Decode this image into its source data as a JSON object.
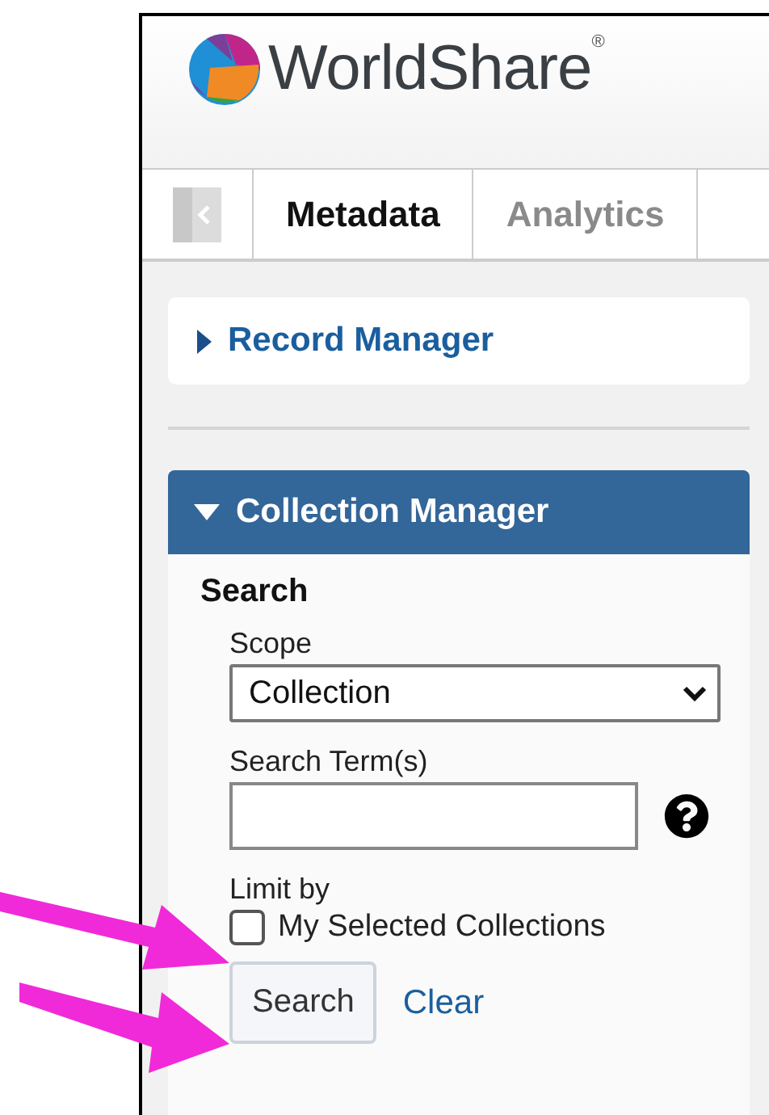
{
  "logo": {
    "text": "WorldShare",
    "mark": "®"
  },
  "tabs": [
    {
      "label": "Metadata",
      "selected": true
    },
    {
      "label": "Analytics",
      "selected": false
    }
  ],
  "sections": [
    {
      "title": "Record Manager",
      "expanded": false
    },
    {
      "title": "Collection Manager",
      "expanded": true
    }
  ],
  "search": {
    "heading": "Search",
    "scope_label": "Scope",
    "scope_value": "Collection",
    "term_label": "Search Term(s)",
    "limit_label": "Limit by",
    "limit_option": {
      "label": "My Selected Collections",
      "checked": false
    },
    "buttons": [
      {
        "label": "Search",
        "kind": "button"
      },
      {
        "label": "Clear",
        "kind": "link"
      }
    ]
  }
}
